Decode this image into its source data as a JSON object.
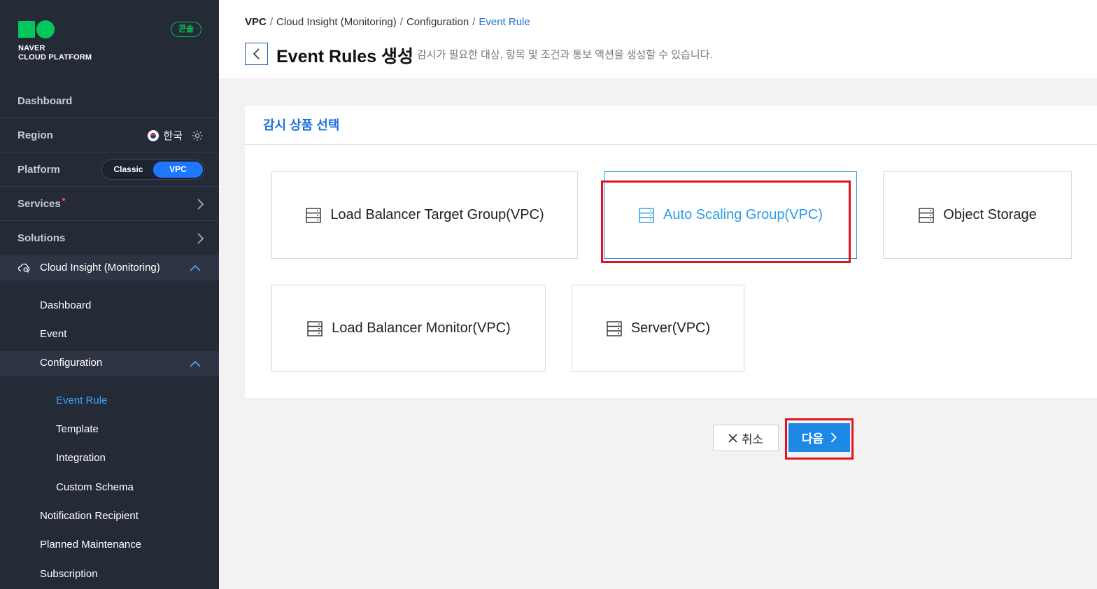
{
  "brand": {
    "logo_line1": "NAVER",
    "logo_line2": "CLOUD PLATFORM",
    "console_badge": "콘솔",
    "accent_color": "#03c75a"
  },
  "sidebar": {
    "dashboard": "Dashboard",
    "region_label": "Region",
    "region_value": "한국",
    "platform_label": "Platform",
    "platform_options": [
      "Classic",
      "VPC"
    ],
    "platform_selected": "VPC",
    "services": "Services",
    "solutions": "Solutions",
    "cloud_insight": "Cloud Insight (Monitoring)",
    "sub_items": {
      "dashboard": "Dashboard",
      "event": "Event",
      "configuration": "Configuration",
      "notification_recipient": "Notification Recipient",
      "planned_maintenance": "Planned Maintenance",
      "subscription": "Subscription"
    },
    "config_items": [
      "Event Rule",
      "Template",
      "Integration",
      "Custom Schema"
    ],
    "active_item": "Event Rule"
  },
  "header": {
    "breadcrumb": [
      "VPC",
      "Cloud Insight (Monitoring)",
      "Configuration",
      "Event Rule"
    ],
    "breadcrumb_sep": "/",
    "title": "Event Rules 생성",
    "description": "감시가 필요한 대상, 항목 및 조건과 통보 액션을 생성할 수 있습니다."
  },
  "panel": {
    "title": "감시 상품 선택",
    "products": [
      "Load Balancer Target Group(VPC)",
      "Auto Scaling Group(VPC)",
      "Object Storage",
      "Load Balancer Monitor(VPC)",
      "Server(VPC)"
    ],
    "selected_product": "Auto Scaling Group(VPC)"
  },
  "actions": {
    "cancel_label": "취소",
    "next_label": "다음"
  },
  "colors": {
    "sidebar_bg": "#252a37",
    "primary": "#1e88e5",
    "selected_text": "#2b9de6",
    "highlight": "#e0141e"
  }
}
